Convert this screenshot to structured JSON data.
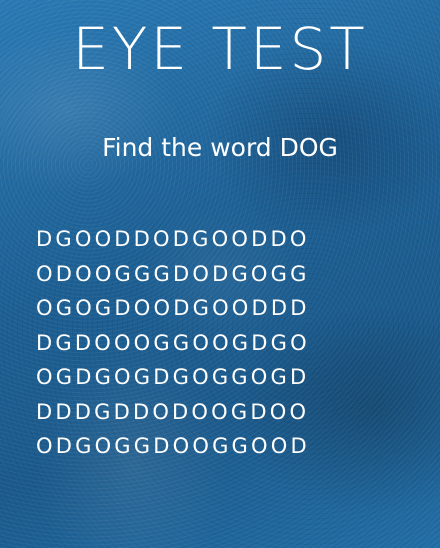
{
  "title": "EYE TEST",
  "instruction": "Find the word DOG",
  "letter_grid": [
    "DGOODDODGOODDO",
    "ODOOGGGDODGOGG",
    "OGOGDOODGOODDD",
    "DGDOOOGGOOGDGO",
    "OGDGOGDGOGGOGD",
    "DDDGDDODOOGDOO",
    "ODGOGGDOOGGOOD"
  ],
  "colors": {
    "background": "#1f6aa0",
    "text": "#ffffff"
  }
}
